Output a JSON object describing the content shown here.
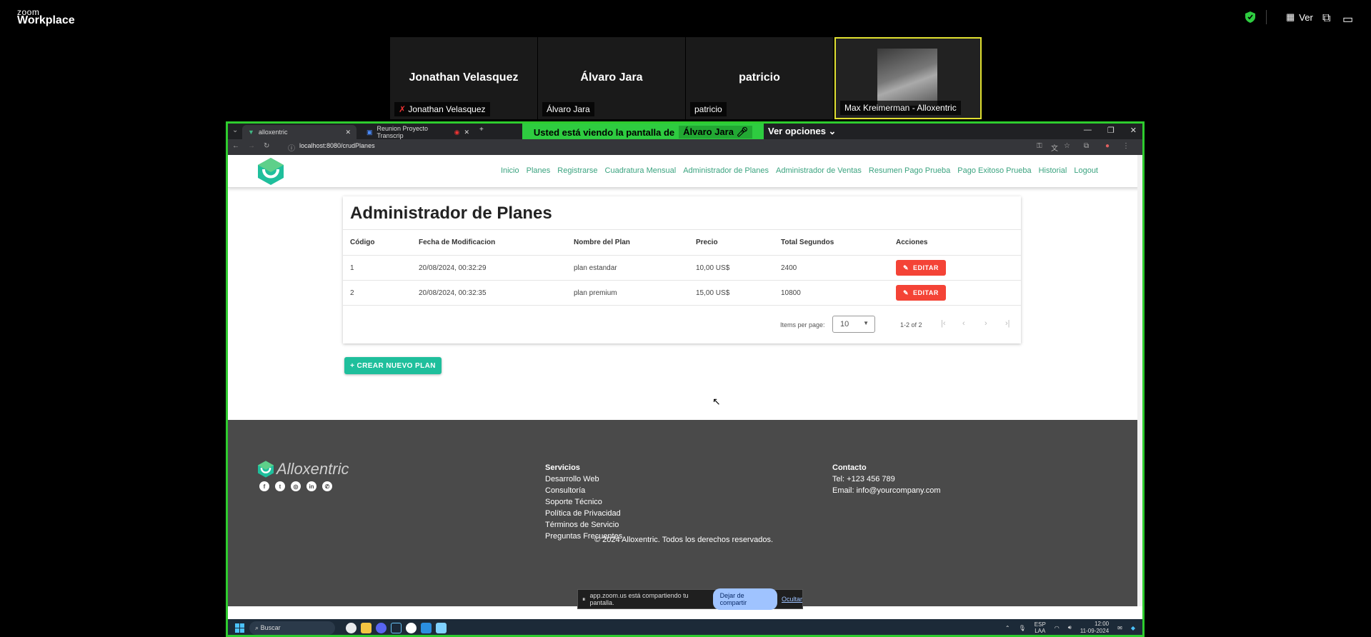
{
  "zoom": {
    "logo_top": "zoom",
    "logo_bottom": "Workplace",
    "ver_label": "Ver",
    "participants": [
      {
        "display": "Jonathan Velasquez",
        "label": "Jonathan Velasquez"
      },
      {
        "display": "Álvaro Jara",
        "label": "Álvaro Jara"
      },
      {
        "display": "patricio",
        "label": "patricio"
      },
      {
        "display": "",
        "label": "Max Kreimerman - Alloxentric"
      }
    ],
    "banner_prefix": "Usted está viendo la pantalla de",
    "banner_name": "Álvaro Jara",
    "ver_opciones": "Ver opciones"
  },
  "browser": {
    "tabs": [
      {
        "title": "alloxentric"
      },
      {
        "title": "Reunion Proyecto Transcrip"
      }
    ],
    "url": "localhost:8080/crudPlanes"
  },
  "site": {
    "nav": [
      "Inicio",
      "Planes",
      "Registrarse",
      "Cuadratura Mensual",
      "Administrador de Planes",
      "Administrador de Ventas",
      "Resumen Pago Prueba",
      "Pago Exitoso Prueba",
      "Historial",
      "Logout"
    ],
    "page_title": "Administrador de Planes",
    "table": {
      "headers": [
        "Código",
        "Fecha de Modificacion",
        "Nombre del Plan",
        "Precio",
        "Total Segundos",
        "Acciones"
      ],
      "rows": [
        {
          "codigo": "1",
          "fecha": "20/08/2024, 00:32:29",
          "nombre": "plan estandar",
          "precio": "10,00 US$",
          "segundos": "2400",
          "accion": "EDITAR"
        },
        {
          "codigo": "2",
          "fecha": "20/08/2024, 00:32:35",
          "nombre": "plan premium",
          "precio": "15,00 US$",
          "segundos": "10800",
          "accion": "EDITAR"
        }
      ]
    },
    "pager": {
      "items_per_page_label": "Items per page:",
      "items_per_page": "10",
      "range": "1-2 of 2"
    },
    "create_button": "+ CREAR NUEVO PLAN",
    "footer": {
      "brand": "Alloxentric",
      "services_title": "Servicios",
      "services": [
        "Desarrollo Web",
        "Consultoría",
        "Soporte Técnico",
        "Política de Privacidad",
        "Términos de Servicio",
        "Preguntas Frecuentes"
      ],
      "contact_title": "Contacto",
      "phone": "Tel: +123 456 789",
      "email": "Email: info@yourcompany.com",
      "copyright": "© 2024 Alloxentric. Todos los derechos reservados."
    }
  },
  "toast": {
    "text": "app.zoom.us está compartiendo tu pantalla.",
    "stop": "Dejar de compartir",
    "hide": "Ocultar"
  },
  "taskbar": {
    "search": "Buscar",
    "lang_top": "ESP",
    "lang_bottom": "LAA",
    "time": "12:00",
    "date": "11-09-2024"
  },
  "colors": {
    "share_border": "#2ecc2e",
    "accent_green": "#3aa37f",
    "edit_red": "#f44336",
    "create_teal": "#1fbf9c"
  }
}
